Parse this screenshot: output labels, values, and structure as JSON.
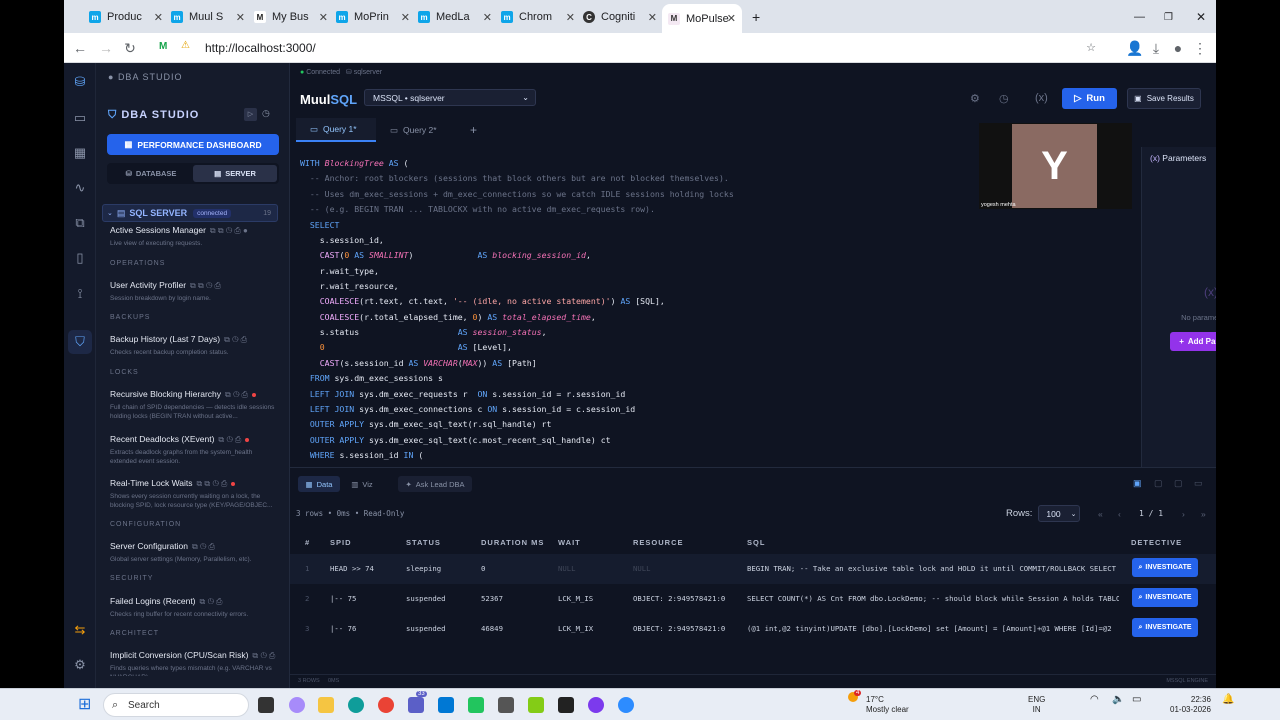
{
  "browser": {
    "tabs": [
      {
        "label": "Produc",
        "fav_color": "#0ea5e9",
        "fav": "m"
      },
      {
        "label": "Muul S",
        "fav_color": "#0ea5e9",
        "fav": "m"
      },
      {
        "label": "My Bus",
        "fav_color": "#ffffff",
        "fav": "M"
      },
      {
        "label": "MoPrin",
        "fav_color": "#0ea5e9",
        "fav": "m"
      },
      {
        "label": "MedLa",
        "fav_color": "#0ea5e9",
        "fav": "m"
      },
      {
        "label": "Chrom",
        "fav_color": "#0ea5e9",
        "fav": "m"
      },
      {
        "label": "Cogniti",
        "fav_color": "#333333",
        "fav": "C"
      },
      {
        "label": "MoPulse",
        "fav_color": "#f4e9f3",
        "fav": "M"
      }
    ],
    "url": "http://localhost:3000/"
  },
  "sidebar": {
    "app_label": "DBA STUDIO",
    "heading": "DBA STUDIO",
    "perf_button": "PERFORMANCE DASHBOARD",
    "seg_database": "DATABASE",
    "seg_server": "SERVER",
    "server_label": "SQL SERVER",
    "server_badge": "connected",
    "server_count": "19",
    "items": [
      {
        "name": "Active Sessions Manager",
        "desc": "Live view of executing requests."
      },
      {
        "name": "User Activity Profiler",
        "desc": "Session breakdown by login name."
      },
      {
        "name": "Backup History (Last 7 Days)",
        "desc": "Checks recent backup completion status."
      },
      {
        "name": "Recursive Blocking Hierarchy",
        "desc": "Full chain of SPID dependencies — detects idle sessions holding locks (BEGIN TRAN without active..."
      },
      {
        "name": "Recent Deadlocks (XEvent)",
        "desc": "Extracts deadlock graphs from the system_health extended event session."
      },
      {
        "name": "Real-Time Lock Waits",
        "desc": "Shows every session currently waiting on a lock, the blocking SPID, lock resource type (KEY/PAGE/OBJEC..."
      },
      {
        "name": "Server Configuration",
        "desc": "Global server settings (Memory, Parallelism, etc)."
      },
      {
        "name": "Failed Logins (Recent)",
        "desc": "Checks ring buffer for recent connectivity errors."
      },
      {
        "name": "Implicit Conversion (CPU/Scan Risk)",
        "desc": "Finds queries where types mismatch (e.g. VARCHAR vs NVARCHAR)..."
      }
    ],
    "categories": [
      "OPERATIONS",
      "BACKUPS",
      "LOCKS",
      "CONFIGURATION",
      "SECURITY",
      "ARCHITECT"
    ]
  },
  "header": {
    "status": "Connected",
    "db_short": "sqlserver",
    "brand_a": "Muul",
    "brand_b": "SQL",
    "db_select": "MSSQL • sqlserver",
    "run": "Run",
    "save": "Save Results",
    "tabs": [
      "Query 1*",
      "Query 2*"
    ]
  },
  "params": {
    "title": "Parameters",
    "empty": "No parameters yet",
    "add": "Add Parameter",
    "video_initial": "Y",
    "video_name": "yogesh mehta"
  },
  "results": {
    "tab_data": "Data",
    "tab_viz": "Viz",
    "ask": "Ask Lead DBA",
    "meta": "3 rows • 0ms • Read-Only",
    "rows_label": "Rows:",
    "rows_value": "100",
    "page": "1 / 1",
    "columns": [
      "#",
      "SPID",
      "STATUS",
      "DURATION MS",
      "WAIT",
      "RESOURCE",
      "SQL",
      "DETECTIVE"
    ],
    "rows": [
      {
        "n": "1",
        "spid": "HEAD >> 74",
        "status": "sleeping",
        "dur": "0",
        "wait": "NULL",
        "res": "NULL",
        "sql": "BEGIN TRAN; -- Take an exclusive table lock and HOLD it until COMMIT/ROLLBACK SELECT TOP ...",
        "btn": "INVESTIGATE"
      },
      {
        "n": "2",
        "spid": "|-- 75",
        "status": "suspended",
        "dur": "52367",
        "wait": "LCK_M_IS",
        "res": "OBJECT: 2:949578421:0",
        "sql": "SELECT COUNT(*) AS Cnt FROM dbo.LockDemo; -- should block while Session A holds TABLOCKX",
        "btn": "INVESTIGATE"
      },
      {
        "n": "3",
        "spid": "|-- 76",
        "status": "suspended",
        "dur": "46849",
        "wait": "LCK_M_IX",
        "res": "OBJECT: 2:949578421:0",
        "sql": "(@1 int,@2 tinyint)UPDATE [dbo].[LockDemo] set [Amount] = [Amount]+@1 WHERE [Id]=@2",
        "btn": "INVESTIGATE"
      }
    ],
    "footer_left": "3 ROWS",
    "footer_mid": "0MS",
    "footer_right": "MSSQL ENGINE"
  },
  "taskbar": {
    "search": "Search",
    "temp": "17°C",
    "weather": "Mostly clear",
    "weather_badge": "4",
    "lang1": "ENG",
    "lang2": "IN",
    "time": "22:36",
    "date": "01-03-2026",
    "vscode_badge": "33"
  }
}
